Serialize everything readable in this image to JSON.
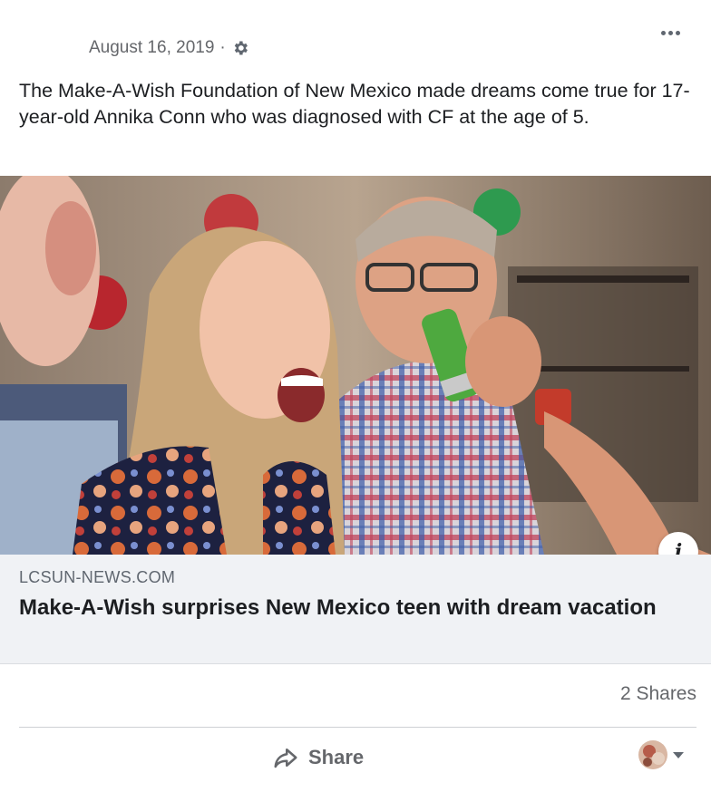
{
  "post": {
    "date": "August 16, 2019",
    "separator": "·",
    "privacy_icon": "gear-icon",
    "more_icon": "more-options-icon",
    "caption": "The Make-A-Wish Foundation of New Mexico made dreams come true for 17-year-old Annika Conn who was diagnosed with CF at the age of 5."
  },
  "link_preview": {
    "domain": "LCSUN-NEWS.COM",
    "title": "Make-A-Wish surprises New Mexico teen with dream vacation",
    "info_icon": "info-icon",
    "info_glyph": "i"
  },
  "stats": {
    "shares": "2 Shares"
  },
  "actions": {
    "share_label": "Share",
    "share_icon": "share-arrow-icon",
    "audience_icon": "chevron-down-icon"
  },
  "colors": {
    "secondary_text": "#65676b",
    "link_box_bg": "#f0f2f5",
    "divider": "#ced0d4"
  }
}
